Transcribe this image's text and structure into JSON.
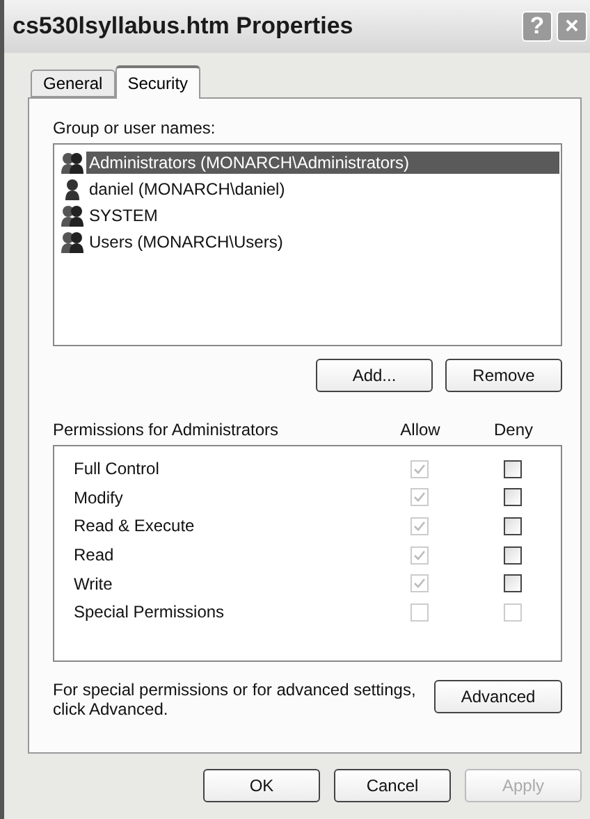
{
  "window": {
    "title": "cs530lsyllabus.htm Properties",
    "help_glyph": "?",
    "close_glyph": "×"
  },
  "tabs": [
    {
      "label": "General",
      "selected": false
    },
    {
      "label": "Security",
      "selected": true
    }
  ],
  "groups": {
    "label": "Group or user names:",
    "items": [
      {
        "name": "Administrators (MONARCH\\Administrators)",
        "kind": "group",
        "selected": true
      },
      {
        "name": "daniel (MONARCH\\daniel)",
        "kind": "user",
        "selected": false
      },
      {
        "name": "SYSTEM",
        "kind": "group",
        "selected": false
      },
      {
        "name": "Users (MONARCH\\Users)",
        "kind": "group",
        "selected": false
      }
    ],
    "buttons": [
      "Add...",
      "Remove"
    ]
  },
  "permissions": {
    "label": "Permissions for Administrators",
    "allow_header": "Allow",
    "deny_header": "Deny",
    "rows": [
      {
        "name": "Full Control",
        "allow": {
          "checked": true,
          "disabled": true
        },
        "deny": {
          "checked": false,
          "disabled": false
        }
      },
      {
        "name": "Modify",
        "allow": {
          "checked": true,
          "disabled": true
        },
        "deny": {
          "checked": false,
          "disabled": false
        }
      },
      {
        "name": "Read & Execute",
        "allow": {
          "checked": true,
          "disabled": true
        },
        "deny": {
          "checked": false,
          "disabled": false
        }
      },
      {
        "name": "Read",
        "allow": {
          "checked": true,
          "disabled": true
        },
        "deny": {
          "checked": false,
          "disabled": false
        }
      },
      {
        "name": "Write",
        "allow": {
          "checked": true,
          "disabled": true
        },
        "deny": {
          "checked": false,
          "disabled": false
        }
      },
      {
        "name": "Special Permissions",
        "allow": {
          "checked": false,
          "disabled": true
        },
        "deny": {
          "checked": false,
          "disabled": true
        }
      }
    ]
  },
  "advanced": {
    "text": "For special permissions or for advanced settings, click Advanced.",
    "button": "Advanced"
  },
  "footer": [
    {
      "label": "OK",
      "disabled": false
    },
    {
      "label": "Cancel",
      "disabled": false
    },
    {
      "label": "Apply",
      "disabled": true
    }
  ]
}
